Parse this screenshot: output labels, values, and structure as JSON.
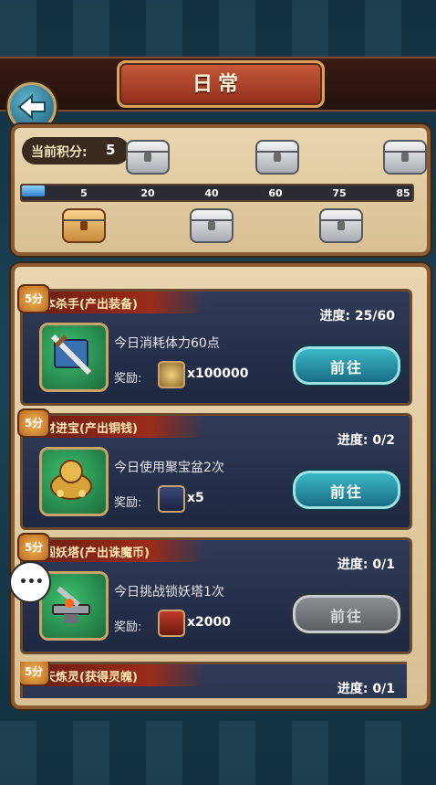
{
  "header": {
    "title": "日常"
  },
  "points": {
    "label": "当前积分:",
    "value": "5",
    "progress_fraction": 0.0588,
    "ticks": [
      "5",
      "20",
      "40",
      "60",
      "75",
      "85"
    ],
    "chests_top": [
      "silver-chest-icon",
      "silver-chest-icon",
      "silver-chest-icon"
    ],
    "chests_bottom": [
      "gold-chest-icon",
      "silver-chest-icon",
      "silver-chest-icon"
    ]
  },
  "tasks": [
    {
      "badge": "5分",
      "title": "副本杀手(产出装备)",
      "progress": "进度: 25/60",
      "desc": "今日消耗体力60点",
      "reward_label": "奖励:",
      "reward_amount": "x100000",
      "button": "前往",
      "icon": "sword-book-icon",
      "reward_icon": "coin-icon"
    },
    {
      "badge": "5分",
      "title": "招财进宝(产出铜钱)",
      "progress": "进度: 0/2",
      "desc": "今日使用聚宝盆2次",
      "reward_label": "奖励:",
      "reward_amount": "x5",
      "button": "前往",
      "icon": "treasure-bowl-icon",
      "reward_icon": "scroll-icon"
    },
    {
      "badge": "5分",
      "title": "勇闯妖塔(产出诛魔币)",
      "progress": "进度: 0/1",
      "desc": "今日挑战锁妖塔1次",
      "reward_label": "奖励:",
      "reward_amount": "x2000",
      "button": "前往",
      "icon": "anvil-icon",
      "reward_icon": "book-icon"
    },
    {
      "badge": "5分",
      "title": "天天炼灵(获得灵魄)",
      "progress": "进度: 0/1"
    }
  ],
  "colors": {
    "accent": "#3bb7c7",
    "panel": "#e9d6b0",
    "title_plate": "#c65a3a"
  }
}
